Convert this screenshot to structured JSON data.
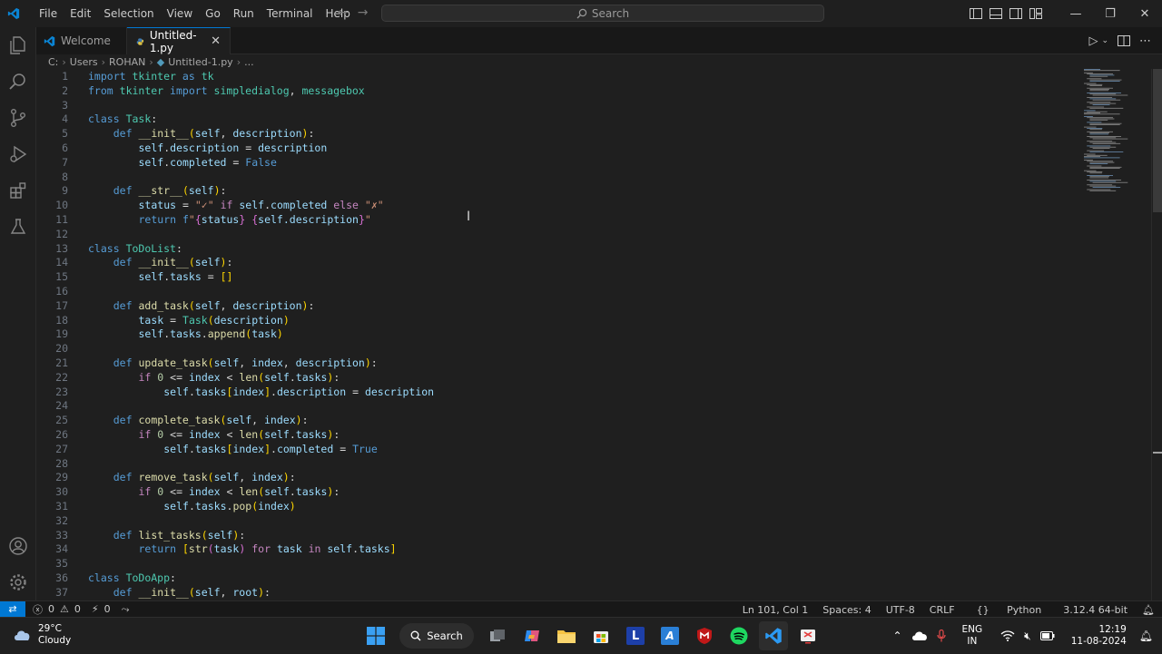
{
  "menu": [
    "File",
    "Edit",
    "Selection",
    "View",
    "Go",
    "Run",
    "Terminal",
    "Help"
  ],
  "search": {
    "label": "Search"
  },
  "tabs": [
    {
      "label": "Welcome",
      "icon": "vscode-icon"
    },
    {
      "label": "Untitled-1.py",
      "icon": "python-icon"
    }
  ],
  "breadcrumb": [
    "C:",
    "Users",
    "ROHAN",
    "Untitled-1.py",
    "..."
  ],
  "status": {
    "errors": "0",
    "warnings": "0",
    "ports": "0",
    "position": "Ln 101, Col 1",
    "spaces": "Spaces: 4",
    "encoding": "UTF-8",
    "eol": "CRLF",
    "language": "Python",
    "interpreter": "3.12.4 64-bit"
  },
  "taskbar": {
    "temperature": "29°C",
    "condition": "Cloudy",
    "search_label": "Search",
    "lang_top": "ENG",
    "lang_bottom": "IN",
    "time": "12:19",
    "date": "11-08-2024"
  },
  "code_lines": [
    "import tkinter as tk",
    "from tkinter import simpledialog, messagebox",
    "",
    "class Task:",
    "    def __init__(self, description):",
    "        self.description = description",
    "        self.completed = False",
    "",
    "    def __str__(self):",
    "        status = \"✓\" if self.completed else \"✗\"",
    "        return f\"{status} {self.description}\"",
    "",
    "class ToDoList:",
    "    def __init__(self):",
    "        self.tasks = []",
    "",
    "    def add_task(self, description):",
    "        task = Task(description)",
    "        self.tasks.append(task)",
    "",
    "    def update_task(self, index, description):",
    "        if 0 <= index < len(self.tasks):",
    "            self.tasks[index].description = description",
    "",
    "    def complete_task(self, index):",
    "        if 0 <= index < len(self.tasks):",
    "            self.tasks[index].completed = True",
    "",
    "    def remove_task(self, index):",
    "        if 0 <= index < len(self.tasks):",
    "            self.tasks.pop(index)",
    "",
    "    def list_tasks(self):",
    "        return [str(task) for task in self.tasks]",
    "",
    "class ToDoApp:",
    "    def __init__(self, root):"
  ]
}
